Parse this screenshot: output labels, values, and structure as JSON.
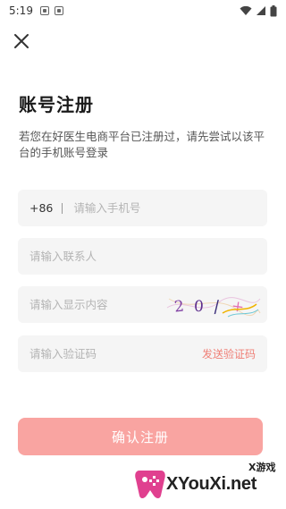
{
  "status_bar": {
    "time": "5:19"
  },
  "page": {
    "title": "账号注册",
    "subtitle": "若您在好医生电商平台已注册过，请先尝试以该平台的手机账号登录"
  },
  "form": {
    "phone": {
      "country_code": "+86",
      "placeholder": "请输入手机号",
      "value": ""
    },
    "contact": {
      "placeholder": "请输入联系人",
      "value": ""
    },
    "display_content": {
      "placeholder": "请输入显示内容",
      "value": "",
      "captcha_text": "20/+"
    },
    "verification_code": {
      "placeholder": "请输入验证码",
      "value": "",
      "send_label": "发送验证码"
    }
  },
  "actions": {
    "confirm_label": "确认注册"
  },
  "watermark": {
    "small": "X游戏",
    "big": "XYouXi.net"
  },
  "colors": {
    "accent": "#f9a4a1",
    "link": "#ef7f76",
    "field_bg": "#f5f5f5"
  }
}
